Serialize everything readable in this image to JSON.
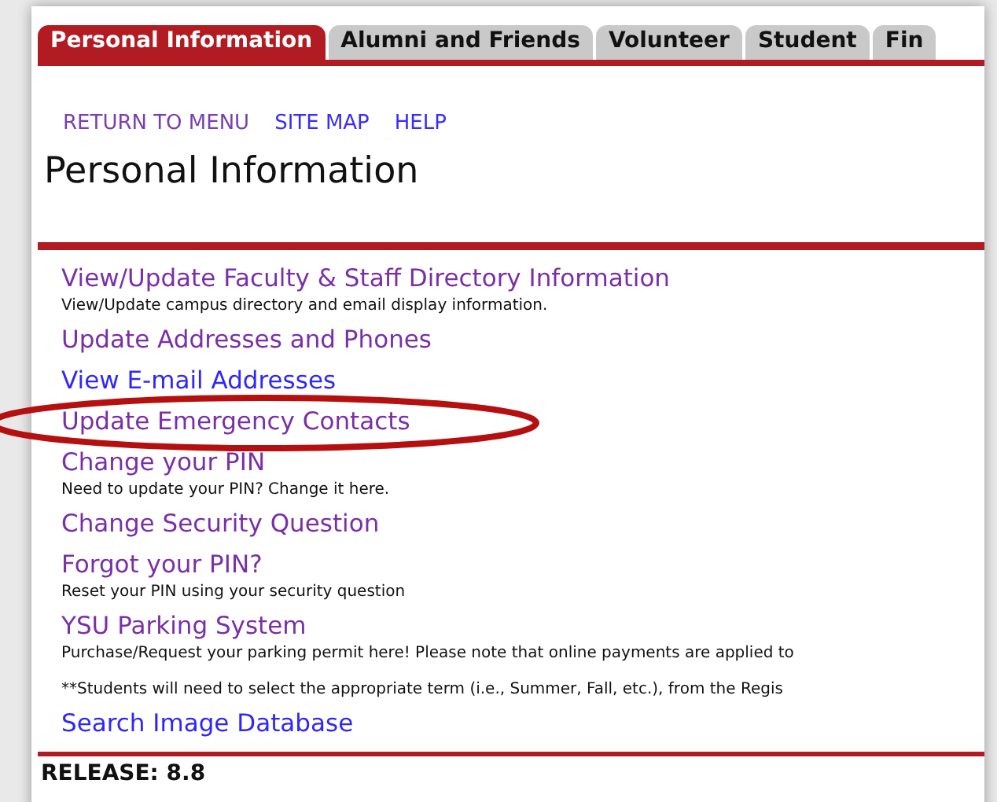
{
  "tabs": [
    {
      "label": "Personal Information",
      "selected": true
    },
    {
      "label": "Alumni and Friends",
      "selected": false
    },
    {
      "label": "Volunteer",
      "selected": false
    },
    {
      "label": "Student",
      "selected": false
    },
    {
      "label": "Fin",
      "selected": false
    }
  ],
  "nav_links": [
    {
      "label": "RETURN TO MENU",
      "visited": true
    },
    {
      "label": "SITE MAP",
      "visited": false
    },
    {
      "label": "HELP",
      "visited": false
    }
  ],
  "title": "Personal Information",
  "menu_items": [
    {
      "kind": "link",
      "label": "View/Update Faculty & Staff Directory Information",
      "visited": true,
      "description": "View/Update campus directory and email display information."
    },
    {
      "kind": "link",
      "label": "Update Addresses and Phones",
      "visited": true
    },
    {
      "kind": "link",
      "label": "View E-mail Addresses",
      "visited": false
    },
    {
      "kind": "link",
      "label": "Update Emergency Contacts",
      "visited": true,
      "highlighted": true
    },
    {
      "kind": "link",
      "label": "Change your PIN",
      "visited": true,
      "description": "Need to update your PIN? Change it here."
    },
    {
      "kind": "link",
      "label": "Change Security Question",
      "visited": true
    },
    {
      "kind": "link",
      "label": "Forgot your PIN?",
      "visited": true,
      "description": "Reset your PIN using your security question"
    },
    {
      "kind": "link",
      "label": "YSU Parking System",
      "visited": true,
      "description": "Purchase/Request your parking permit here! Please note that online payments are applied to"
    },
    {
      "kind": "note",
      "text": "**Students will need to select the appropriate term (i.e., Summer, Fall, etc.), from the Regis"
    },
    {
      "kind": "link",
      "label": "Search Image Database",
      "visited": false
    }
  ],
  "release": "RELEASE: 8.8"
}
